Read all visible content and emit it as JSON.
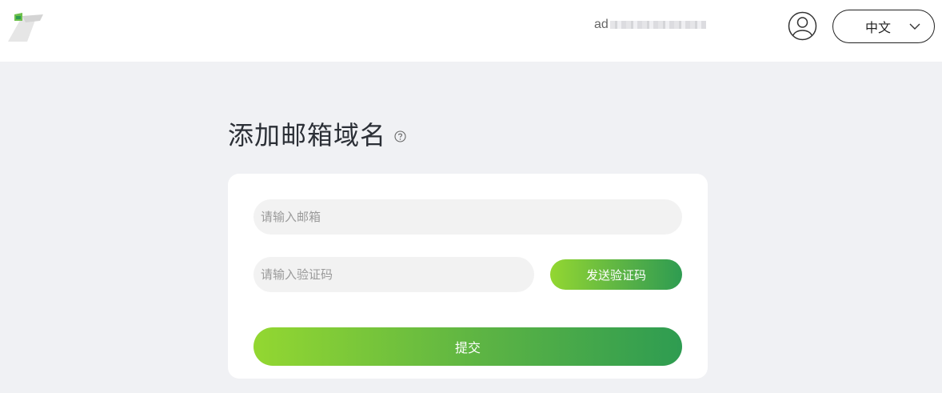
{
  "header": {
    "account_prefix": "ad",
    "language_label": "中文"
  },
  "icons": {
    "logo": "brand-logo",
    "user": "user-icon",
    "chevron": "chevron-down-icon",
    "help": "help-circle-icon"
  },
  "main": {
    "title": "添加邮箱域名"
  },
  "form": {
    "email_placeholder": "请输入邮箱",
    "email_value": "",
    "code_placeholder": "请输入验证码",
    "code_value": "",
    "send_code_label": "发送验证码",
    "submit_label": "提交"
  },
  "colors": {
    "accent_start": "#93d731",
    "accent_end": "#2e9c51",
    "background": "#f0f1f4",
    "input_bg": "#f2f2f2"
  }
}
